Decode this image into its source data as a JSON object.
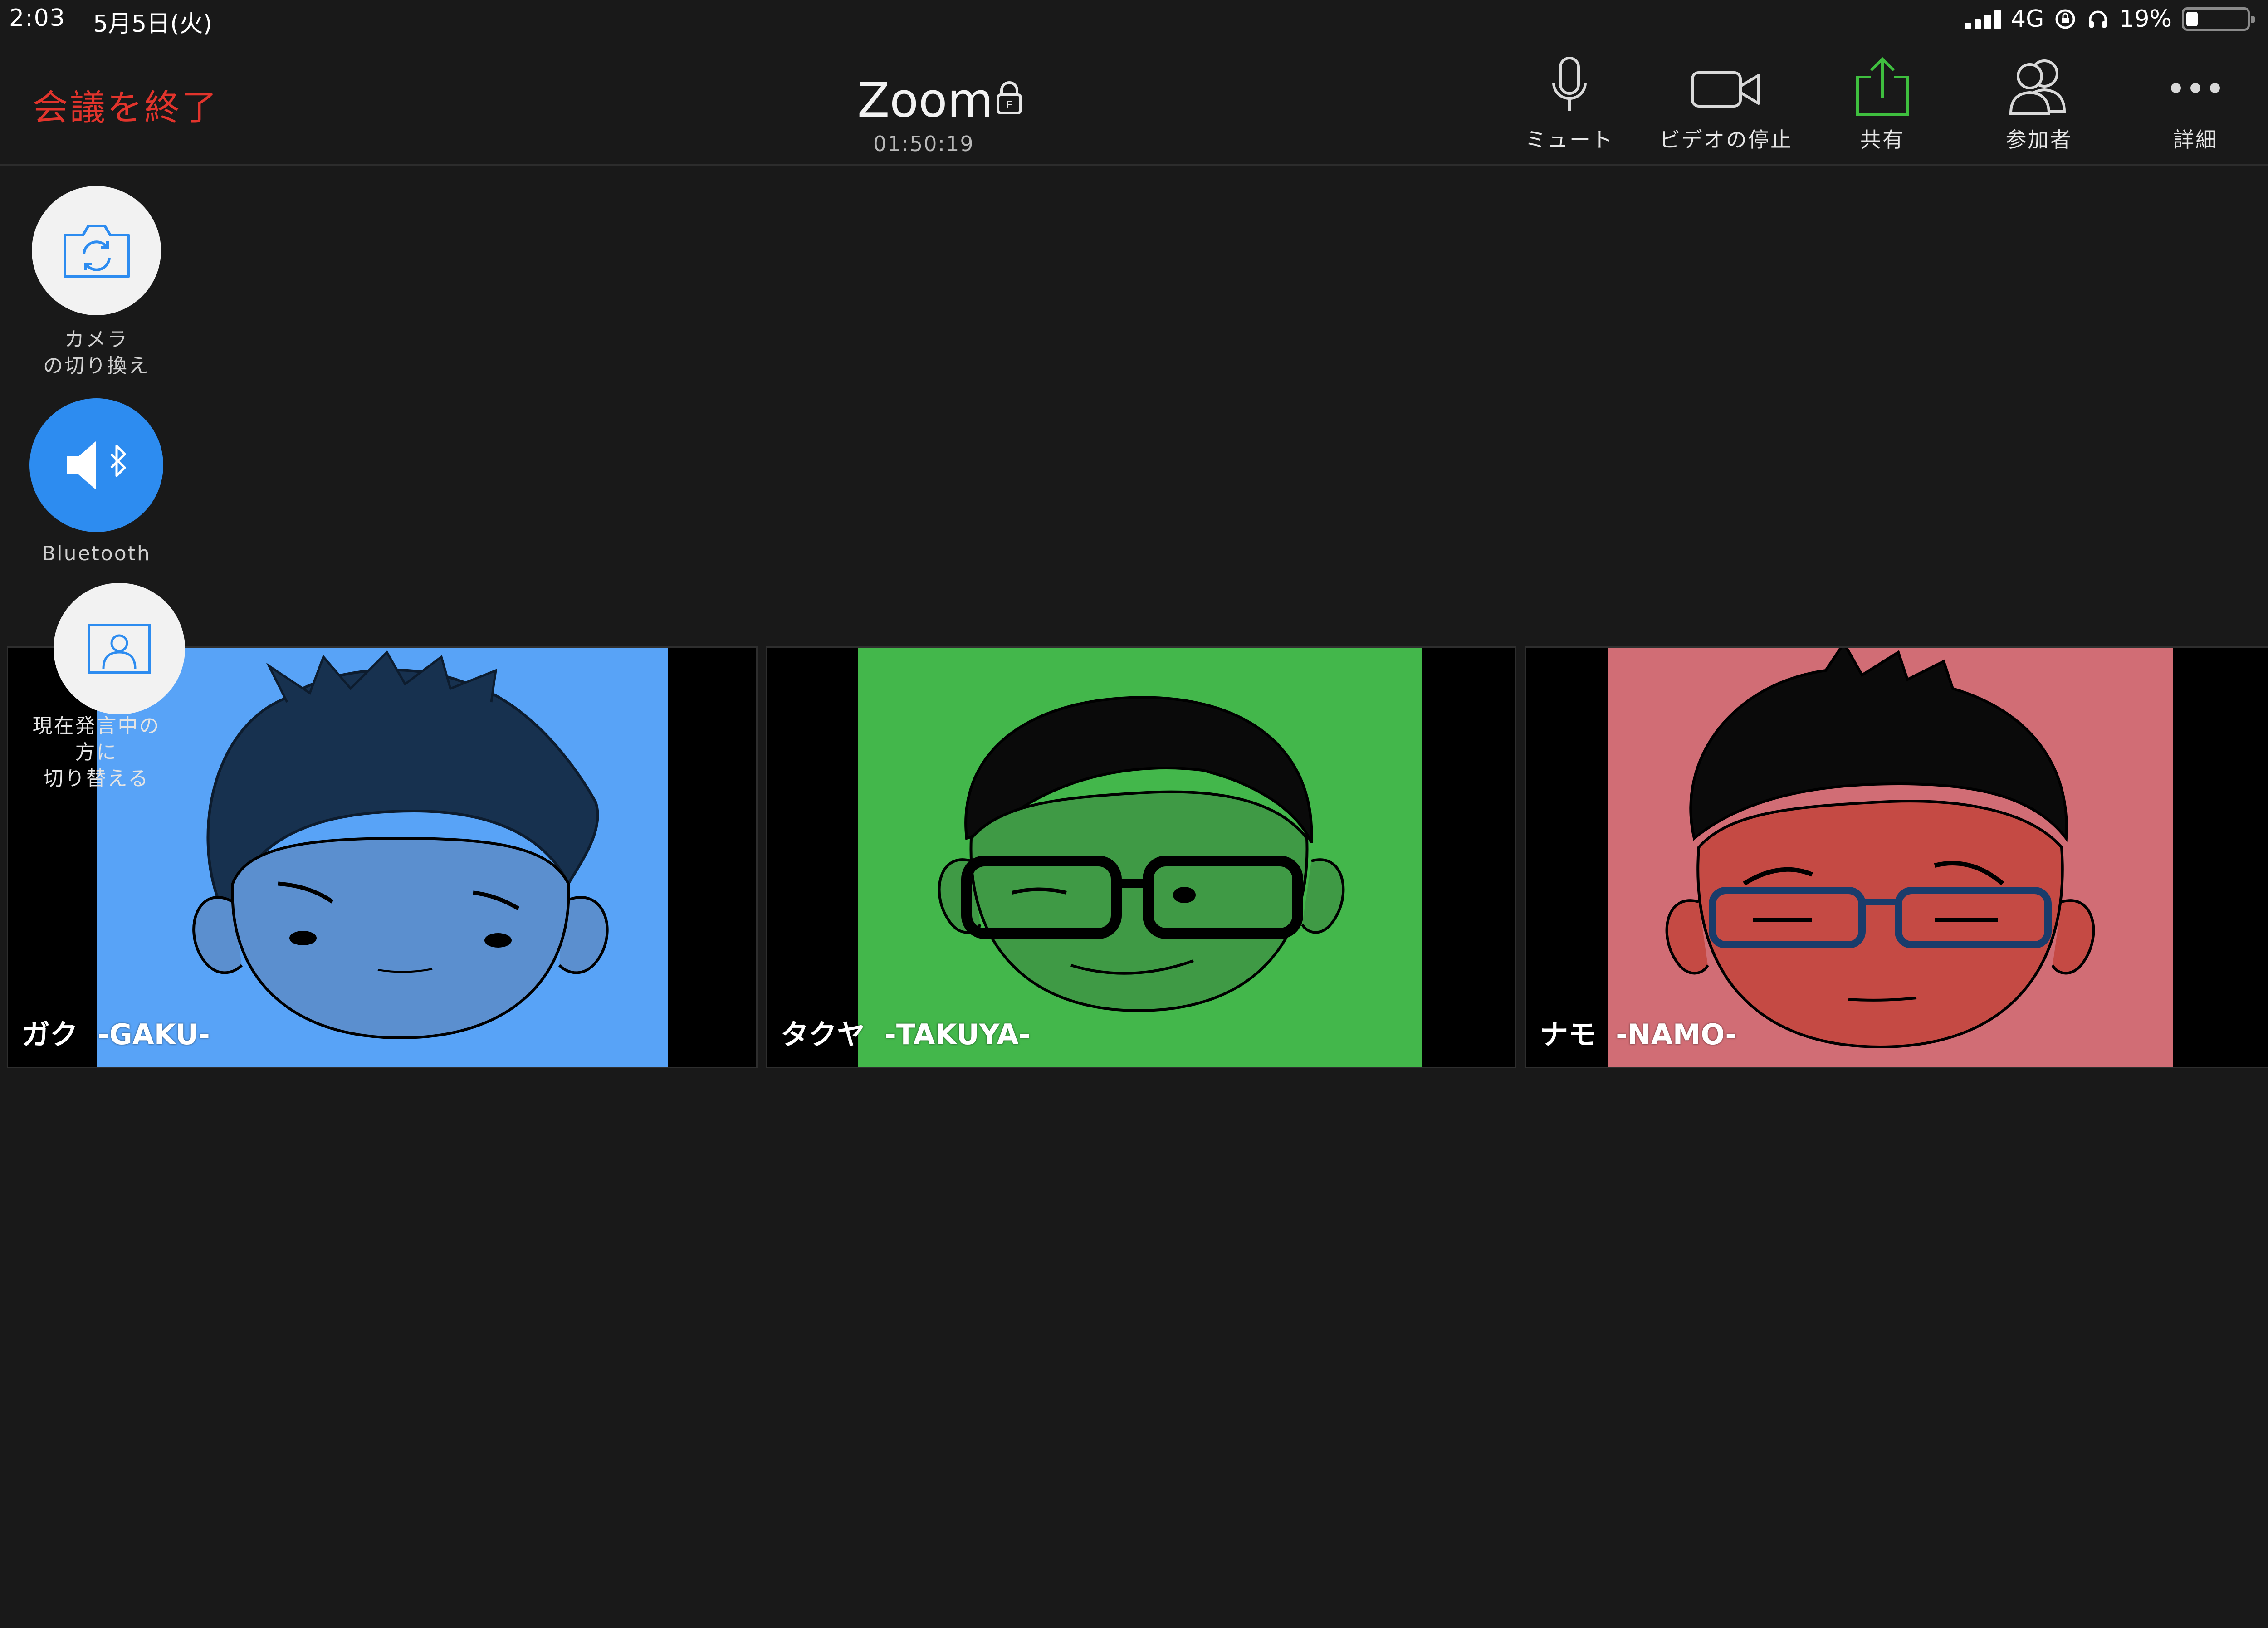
{
  "status_bar": {
    "time": "2:03",
    "date": "5月5日(火)",
    "network": "4G",
    "battery": "19%",
    "battery_level": 0.19
  },
  "toolbar": {
    "end_meeting_label": "会議を終了",
    "meeting_title": "Zoom",
    "meeting_timer": "01:50:19",
    "buttons": [
      {
        "label": "ミュート",
        "icon": "microphone-icon"
      },
      {
        "label": "ビデオの停止",
        "icon": "video-camera-icon"
      },
      {
        "label": "共有",
        "icon": "share-icon"
      },
      {
        "label": "参加者",
        "icon": "participants-icon"
      },
      {
        "label": "詳細",
        "icon": "more-icon"
      }
    ]
  },
  "side_controls": {
    "switch_camera": {
      "line1": "カメラ",
      "line2": "の切り換え",
      "icon": "switch-camera-icon"
    },
    "audio": {
      "label": "Bluetooth",
      "icon": "bluetooth-speaker-icon"
    },
    "speaker_view": {
      "line1": "現在発言中の",
      "line2": "方に",
      "line3": "切り替える",
      "icon": "speaker-view-icon"
    }
  },
  "participants": [
    {
      "name": "ガク  -GAKU-",
      "color": "#58a3f7"
    },
    {
      "name": "タクヤ  -TAKUYA-",
      "color": "#43b74b"
    },
    {
      "name": "ナモ  -NAMO-",
      "color": "#d16d75"
    }
  ],
  "colors": {
    "end_meeting": "#e2342c",
    "accent_blue": "#2d8cf0",
    "share_green": "#3fbf3f",
    "background": "#191919"
  }
}
